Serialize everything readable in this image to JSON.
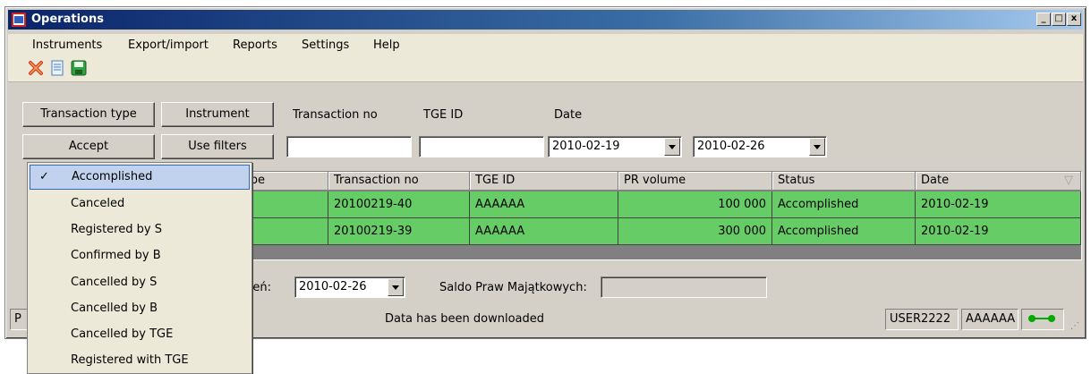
{
  "window": {
    "title": "Operations",
    "controls": [
      "_",
      "□",
      "x"
    ]
  },
  "menu": [
    "Instruments",
    "Export/import",
    "Reports",
    "Settings",
    "Help"
  ],
  "toolbar": {
    "icons": [
      "close-red-icon",
      "document-icon",
      "save-icon"
    ]
  },
  "filters": {
    "transaction_type_button": "Transaction type",
    "instrument_button": "Instrument",
    "accept_button": "Accept",
    "use_filters_button": "Use filters",
    "transaction_no_label": "Transaction no",
    "tge_id_label": "TGE ID",
    "date_label": "Date",
    "transaction_no_value": "",
    "tge_id_value": "",
    "date_from": "2010-02-19",
    "date_to": "2010-02-26"
  },
  "grid": {
    "columns": [
      "Transaction type",
      "Transaction no",
      "TGE ID",
      "PR volume",
      "Status",
      "Date"
    ],
    "column_visible_labels": [
      "type",
      "Transaction no",
      "TGE ID",
      "PR volume",
      "Status",
      "Date"
    ],
    "rows": [
      {
        "transaction_no": "20100219-40",
        "tge_id": "AAAAAA",
        "pr_volume": "100 000",
        "status": "Accomplished",
        "date": "2010-02-19"
      },
      {
        "transaction_no": "20100219-39",
        "tge_id": "AAAAAA",
        "pr_volume": "300 000",
        "status": "Accomplished",
        "date": "2010-02-19"
      }
    ],
    "row_color": "#66cc66"
  },
  "lower": {
    "day_label_suffix": "zień:",
    "day_value": "2010-02-26",
    "balance_label": "Saldo Praw Majątkowych:",
    "balance_value": ""
  },
  "status": {
    "left": "P",
    "message": "Data has been downloaded",
    "user": "USER2222",
    "company": "AAAAAA",
    "connection_icon": "connected-icon",
    "connection_color": "#00aa00"
  },
  "dropdown": {
    "items": [
      {
        "label": "Accomplished",
        "checked": true
      },
      {
        "label": "Canceled",
        "checked": false
      },
      {
        "label": "Registered by S",
        "checked": false
      },
      {
        "label": "Confirmed by B",
        "checked": false
      },
      {
        "label": "Cancelled by S",
        "checked": false
      },
      {
        "label": "Cancelled by B",
        "checked": false
      },
      {
        "label": "Cancelled by TGE",
        "checked": false
      },
      {
        "label": "Registered with TGE",
        "checked": false
      }
    ],
    "check_mark": "✓"
  }
}
